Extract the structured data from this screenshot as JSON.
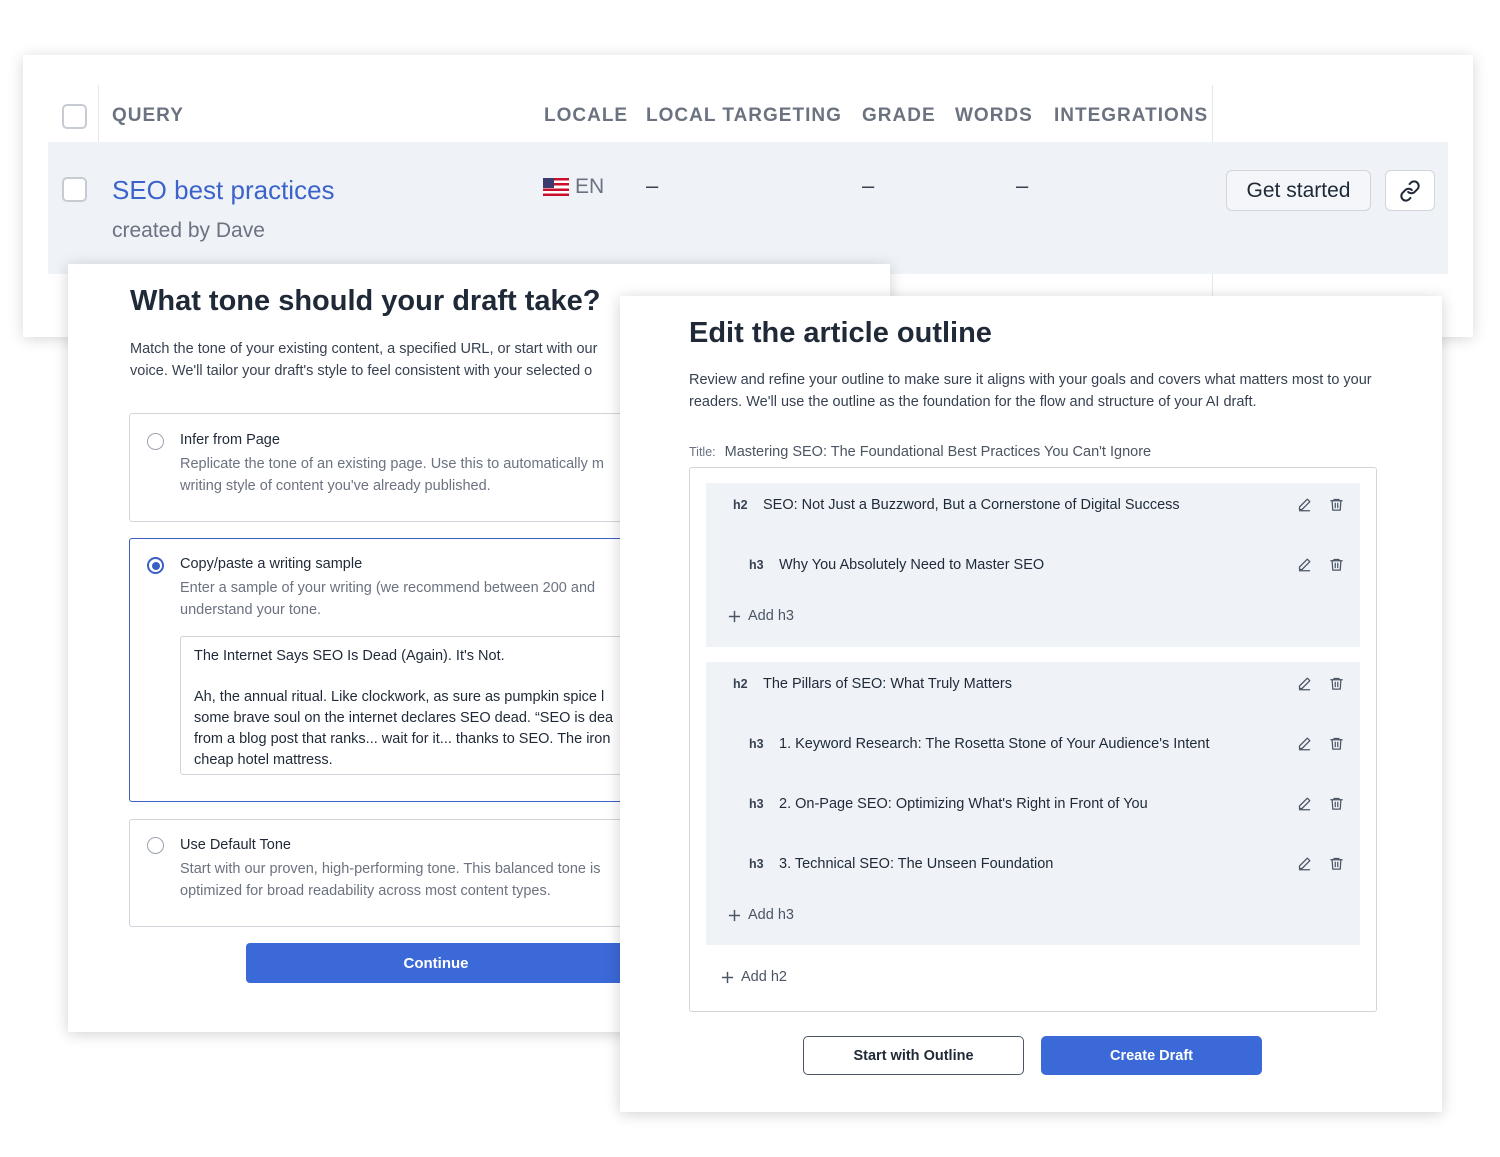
{
  "table": {
    "headers": [
      "QUERY",
      "LOCALE",
      "LOCAL TARGETING",
      "GRADE",
      "WORDS",
      "INTEGRATIONS"
    ],
    "row": {
      "query": "SEO best practices",
      "created_by": "created by Dave",
      "locale": "EN",
      "local_targeting": "–",
      "grade": "–",
      "words": "–",
      "action_label": "Get started",
      "link_icon": "link-icon"
    }
  },
  "tone": {
    "title": "What tone should your draft take?",
    "description_line1": "Match the tone of your existing content, a specified URL, or start with our",
    "description_line2": "voice. We'll tailor your draft's style to feel consistent with your selected o",
    "options": [
      {
        "title": "Infer from Page",
        "desc_line1": "Replicate the tone of an existing page. Use this to automatically m",
        "desc_line2": "writing style of content you've already published.",
        "selected": false
      },
      {
        "title": "Copy/paste a writing sample",
        "desc_line1": "Enter a sample of your writing (we recommend between 200 and",
        "desc_line2": "understand your tone.",
        "selected": true
      },
      {
        "title": "Use Default Tone",
        "desc_line1": "Start with our proven, high-performing tone. This balanced tone is",
        "desc_line2": "optimized for broad readability across most content types.",
        "selected": false
      }
    ],
    "sample_text": {
      "heading": "The Internet Says SEO Is Dead (Again). It's Not.",
      "line1": "Ah, the annual ritual. Like clockwork, as sure as pumpkin spice l",
      "line2": "some brave soul on the internet declares SEO dead. “SEO is dea",
      "line3": "from a blog post that ranks... wait for it... thanks to SEO. The iron",
      "line4": "cheap hotel mattress."
    },
    "continue_label": "Continue"
  },
  "outline": {
    "title": "Edit the article outline",
    "description": "Review and refine your outline to make sure it aligns with your goals and covers what matters most to your readers. We'll use the outline as the foundation for the flow and structure of your AI draft.",
    "title_label": "Title:",
    "title_value": "Mastering SEO: The Foundational Best Practices You Can't Ignore",
    "sections": [
      {
        "tag": "h2",
        "text": "SEO: Not Just a Buzzword, But a Cornerstone of Digital Success",
        "children": [
          {
            "tag": "h3",
            "text": "Why You Absolutely Need to Master SEO"
          }
        ],
        "add_label": "Add h3"
      },
      {
        "tag": "h2",
        "text": "The Pillars of SEO: What Truly Matters",
        "children": [
          {
            "tag": "h3",
            "text": "1. Keyword Research: The Rosetta Stone of Your Audience's Intent"
          },
          {
            "tag": "h3",
            "text": "2. On-Page SEO: Optimizing What's Right in Front of You"
          },
          {
            "tag": "h3",
            "text": "3. Technical SEO: The Unseen Foundation"
          }
        ],
        "add_label": "Add h3"
      }
    ],
    "add_h2_label": "Add h2",
    "start_with_outline_label": "Start with Outline",
    "create_draft_label": "Create Draft"
  },
  "colors": {
    "primary": "#3b69d8",
    "link": "#3b63c9",
    "row_bg": "#eff3f8"
  }
}
